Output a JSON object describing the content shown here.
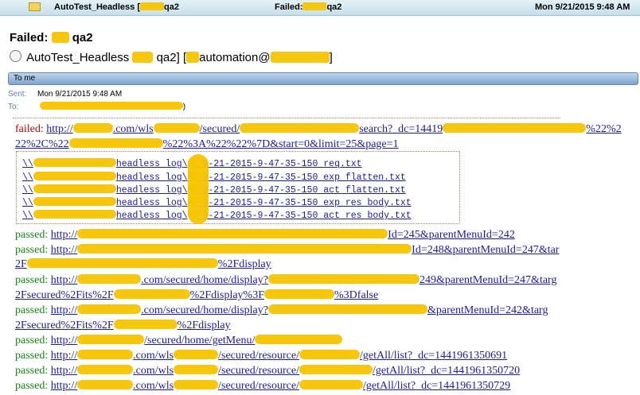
{
  "window": {
    "subject": "AutoTest_Headless [",
    "subject_suffix": "qa2",
    "status_prefix": "Failed:",
    "status_suffix": "qa2",
    "date": "Mon 9/21/2015 9:48 AM"
  },
  "message": {
    "subject_prefix": "Failed:",
    "subject_suffix": "qa2",
    "from_name": "AutoTest_Headless",
    "from_suffix": "qa2] [",
    "from_email": "automation@",
    "from_close": "]",
    "to_bar": "To me",
    "sent_label": "Sent:",
    "sent_value": "Mon 9/21/2015 9:48 AM",
    "to_label": "To:",
    "to_value": ")"
  },
  "results": [
    {
      "status": "failed:",
      "url": "http://",
      "tail": ".com/wls",
      "tail2": "/secured/",
      "tail3": "search?_dc=14419",
      "tail4": "%22%2"
    },
    {
      "url": "22%2C%22",
      "tail": "%22%3A%22%22%7D&start=0&limit=25&page=1"
    }
  ],
  "files": [
    {
      "prefix": "\\\\",
      "mid": "headless log\\",
      "name": "9-21-2015-9-47-35-150 req.txt"
    },
    {
      "prefix": "\\\\",
      "mid": "headless log\\",
      "name": "9-21-2015-9-47-35-150 exp flatten.txt"
    },
    {
      "prefix": "\\\\",
      "mid": "headless log\\",
      "name": "9-21-2015-9-47-35-150 act flatten.txt"
    },
    {
      "prefix": "\\\\",
      "mid": "headless log\\",
      "name": "9-21-2015-9-47-35-150 exp res body.txt"
    },
    {
      "prefix": "\\\\",
      "mid": "headless log\\",
      "name": "9-21-2015-9-47-35-150 act res body.txt"
    }
  ],
  "passed": [
    {
      "label": "passed:",
      "url": "http://",
      "rest": "Id=245&parentMenuId=242"
    },
    {
      "label": "passed:",
      "url": "http://",
      "rest": "Id=248&parentMenuId=247&tar"
    },
    {
      "cont": "2F",
      "rest": "%2Fdisplay"
    },
    {
      "label": "passed:",
      "url": "http://",
      "rest": ".com/secured/home/display?",
      "rest2": "249&parentMenuId=247&targ"
    },
    {
      "cont": "2Fsecured%2Fits%2F",
      "rest": "%2Fdisplay%3F",
      "rest2": "%3Dfalse"
    },
    {
      "label": "passed:",
      "url": "http://",
      "rest": ".com/secured/home/display?",
      "rest2": "&parentMenuId=242&targ"
    },
    {
      "cont": "2Fsecured%2Fits%2F",
      "rest": "%2Fdisplay"
    },
    {
      "label": "passed:",
      "url": "http://",
      "rest": "/secured/home/getMenu/"
    },
    {
      "label": "passed:",
      "url": "http://",
      "rest": ".com/wls",
      "rest2": "/secured/resource/",
      "rest3": "/getAll/list?_dc=1441961350691"
    },
    {
      "label": "passed:",
      "url": "http://",
      "rest": ".com/wls",
      "rest2": "/secured/resource/",
      "rest3": "/getAll/list?_dc=1441961350720"
    },
    {
      "label": "passed:",
      "url": "http://",
      "rest": ".com/wls",
      "rest2": "/secured/resource/",
      "rest3": "/getAll/list?_dc=1441961350729"
    }
  ]
}
